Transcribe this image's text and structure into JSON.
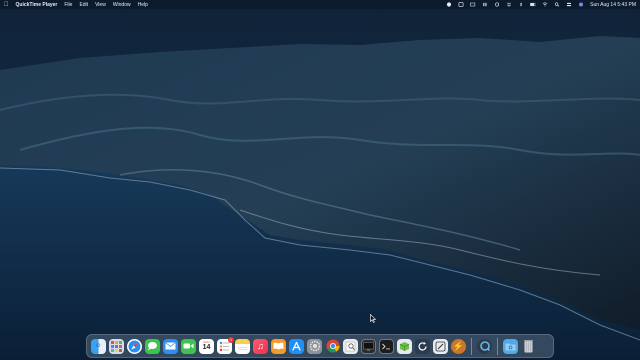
{
  "menubar": {
    "app_name": "QuickTime Player",
    "menus": [
      "File",
      "Edit",
      "View",
      "Window",
      "Help"
    ],
    "clock": "Sun Aug 14  5:43 PM"
  },
  "dock": {
    "calendar_day": "14",
    "calendar_month": "AUG",
    "reminders_badge": "1"
  }
}
